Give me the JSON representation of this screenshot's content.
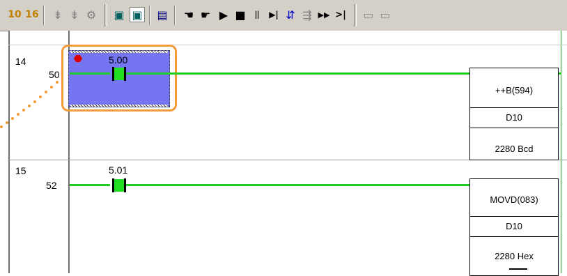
{
  "toolbar": {
    "buttons": [
      {
        "name": "online-monitor-icon",
        "glyph": "10"
      },
      {
        "name": "address-display-icon",
        "glyph": "16"
      },
      {
        "name": "goto-icon",
        "glyph": "⇟"
      },
      {
        "name": "goto-next-icon",
        "glyph": "⇟"
      },
      {
        "name": "find-icon",
        "glyph": "⚙"
      },
      {
        "name": "program-mode-icon",
        "glyph": "▣"
      },
      {
        "name": "monitor-mode-icon",
        "glyph": "▣"
      },
      {
        "name": "transfer-icon",
        "glyph": "▤"
      },
      {
        "name": "force-on-icon",
        "glyph": "☚"
      },
      {
        "name": "force-off-icon",
        "glyph": "☛"
      },
      {
        "name": "run-icon",
        "glyph": "▶"
      },
      {
        "name": "stop-icon",
        "glyph": "■"
      },
      {
        "name": "pause-icon",
        "glyph": "Ⅱ"
      },
      {
        "name": "step-icon",
        "glyph": "▶|"
      },
      {
        "name": "step-in-icon",
        "glyph": "⇵"
      },
      {
        "name": "step-out-icon",
        "glyph": "⇶"
      },
      {
        "name": "fast-forward-icon",
        "glyph": "▶▶"
      },
      {
        "name": "jump-end-icon",
        "glyph": ">|"
      },
      {
        "name": "view-1-icon",
        "glyph": "▭"
      },
      {
        "name": "view-2-icon",
        "glyph": "▭"
      }
    ]
  },
  "rungs": [
    {
      "rung": "14",
      "step": "50",
      "contact": "5.00",
      "instruction": "++B(594)",
      "operand1": "D10",
      "operand2": "2280 Bcd"
    },
    {
      "rung": "15",
      "step": "52",
      "contact": "5.01",
      "instruction": "MOVD(083)",
      "operand1": "D10",
      "operand2": "2280 Hex"
    }
  ]
}
